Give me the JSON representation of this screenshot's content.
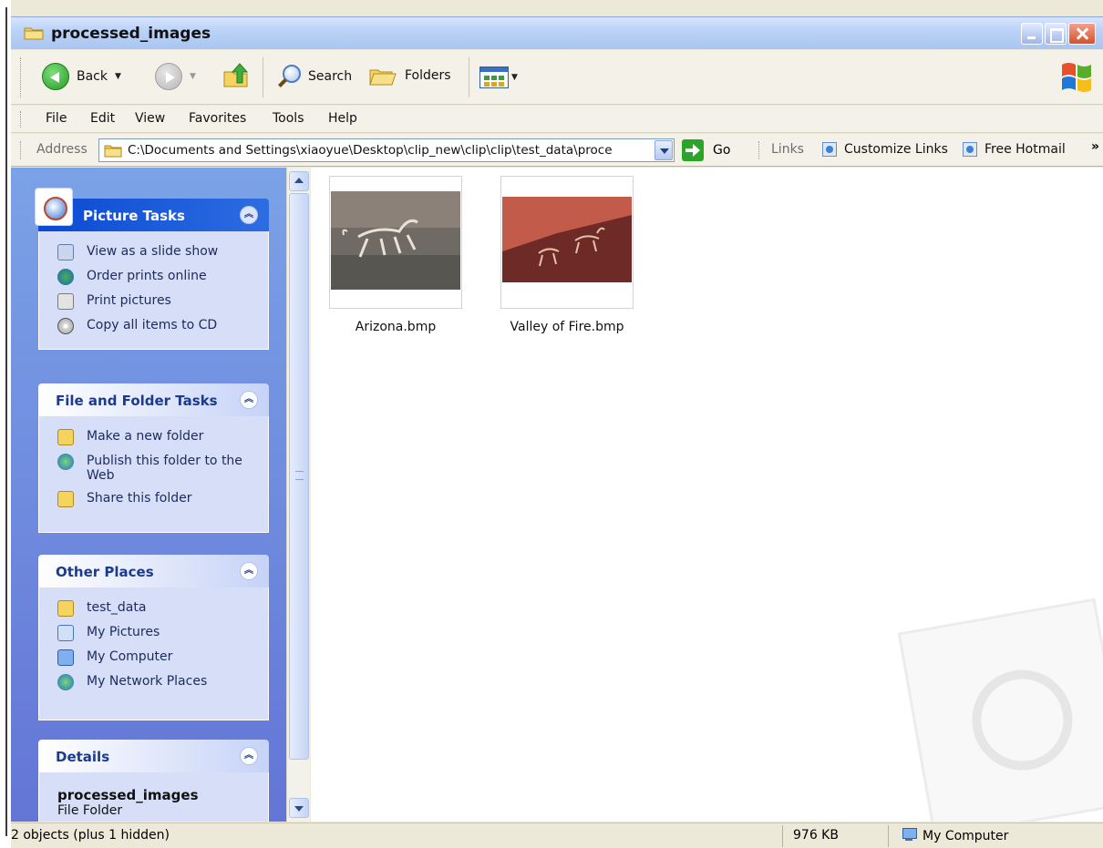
{
  "window": {
    "title": "processed_images"
  },
  "toolbar": {
    "back_label": "Back",
    "search_label": "Search",
    "folders_label": "Folders"
  },
  "menu": {
    "items": [
      "File",
      "Edit",
      "View",
      "Favorites",
      "Tools",
      "Help"
    ]
  },
  "address": {
    "label": "Address",
    "value": "C:\\Documents and Settings\\xiaoyue\\Desktop\\clip_new\\clip\\clip\\test_data\\proce",
    "go_label": "Go",
    "links_label": "Links",
    "link_items": [
      "Customize Links",
      "Free Hotmail"
    ]
  },
  "taskpane": {
    "picture_tasks": {
      "title": "Picture Tasks",
      "items": [
        "View as a slide show",
        "Order prints online",
        "Print pictures",
        "Copy all items to CD"
      ]
    },
    "file_folder_tasks": {
      "title": "File and Folder Tasks",
      "items": [
        "Make a new folder",
        "Publish this folder to the Web",
        "Share this folder"
      ]
    },
    "other_places": {
      "title": "Other Places",
      "items": [
        "test_data",
        "My Pictures",
        "My Computer",
        "My Network Places"
      ]
    },
    "details": {
      "title": "Details",
      "name": "processed_images",
      "type": "File Folder"
    }
  },
  "files": [
    {
      "name": "Arizona.bmp"
    },
    {
      "name": "Valley of Fire.bmp"
    }
  ],
  "status": {
    "objects": "2 objects (plus 1 hidden)",
    "size": "976 KB",
    "location": "My Computer"
  },
  "colors": {
    "taskpane_bg": "#6f8fe0",
    "panel_title": "#1c3b8e",
    "close_red": "#d6502c"
  }
}
